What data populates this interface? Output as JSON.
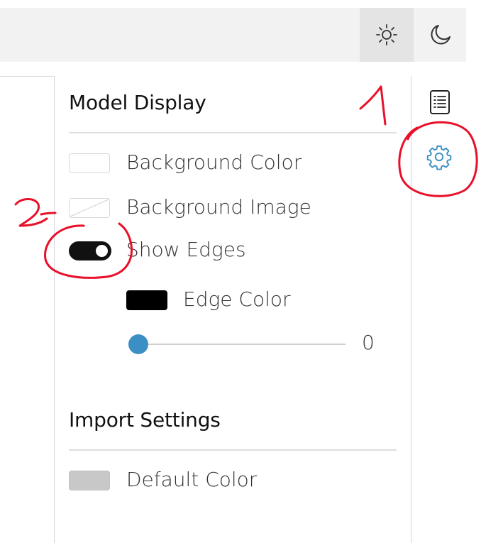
{
  "toolbar": {
    "light_mode_icon": "sun-icon",
    "dark_mode_icon": "moon-icon"
  },
  "sidebar": {
    "items": [
      {
        "icon": "list-icon"
      },
      {
        "icon": "gear-icon",
        "color": "#3b8fc4"
      }
    ]
  },
  "model_display": {
    "title": "Model Display",
    "background_color_label": "Background Color",
    "background_image_label": "Background Image",
    "show_edges_label": "Show Edges",
    "show_edges_on": true,
    "edge_color_label": "Edge Color",
    "edge_color": "#000000",
    "edge_width_value": "0",
    "edge_width_fraction": 0
  },
  "import_settings": {
    "title": "Import Settings",
    "default_color_label": "Default Color",
    "default_color": "#c8c8c8"
  },
  "annotations": {
    "marker_1": "1",
    "marker_2": "2",
    "color": "#e8102a"
  },
  "colors": {
    "accent": "#3b8fc4",
    "topbar_bg": "#f2f2f2"
  }
}
